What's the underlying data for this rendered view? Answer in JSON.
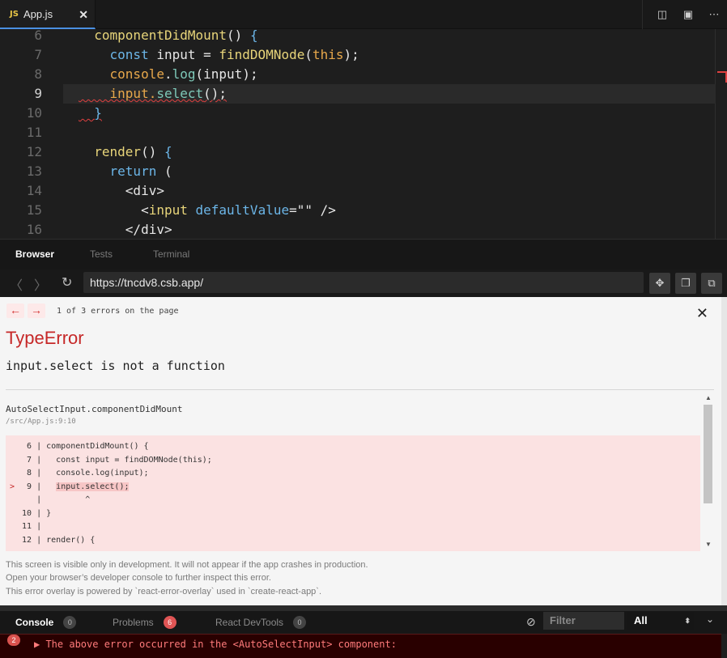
{
  "editor_tab": {
    "lang_badge": "JS",
    "filename": "App.js",
    "close": "✕"
  },
  "tab_actions": {
    "split": "◫",
    "preview": "▣",
    "more": "⋯"
  },
  "code_lines": [
    {
      "num": "6",
      "parts": [
        {
          "t": "  componentDidMount",
          "c": "k-yellow"
        },
        {
          "t": "() ",
          "c": "k-plain"
        },
        {
          "t": "{",
          "c": "k-blue"
        }
      ]
    },
    {
      "num": "7",
      "parts": [
        {
          "t": "    const ",
          "c": "k-blue"
        },
        {
          "t": "input = ",
          "c": "k-plain"
        },
        {
          "t": "findDOMNode",
          "c": "k-yellow"
        },
        {
          "t": "(",
          "c": "k-plain"
        },
        {
          "t": "this",
          "c": "k-orange"
        },
        {
          "t": ");",
          "c": "k-plain"
        }
      ]
    },
    {
      "num": "8",
      "parts": [
        {
          "t": "    console",
          "c": "k-orange"
        },
        {
          "t": ".",
          "c": "k-plain"
        },
        {
          "t": "log",
          "c": "k-teal"
        },
        {
          "t": "(input);",
          "c": "k-plain"
        }
      ]
    },
    {
      "num": "9",
      "parts": [
        {
          "t": "    input.",
          "c": "k-orange"
        },
        {
          "t": "select",
          "c": "k-teal"
        },
        {
          "t": "();",
          "c": "k-plain"
        }
      ]
    },
    {
      "num": "10",
      "parts": [
        {
          "t": "  }",
          "c": "k-blue"
        }
      ]
    },
    {
      "num": "11",
      "parts": []
    },
    {
      "num": "12",
      "parts": [
        {
          "t": "  render",
          "c": "k-yellow"
        },
        {
          "t": "() ",
          "c": "k-plain"
        },
        {
          "t": "{",
          "c": "k-blue"
        }
      ]
    },
    {
      "num": "13",
      "parts": [
        {
          "t": "    return ",
          "c": "k-blue"
        },
        {
          "t": "(",
          "c": "k-plain"
        }
      ]
    },
    {
      "num": "14",
      "parts": [
        {
          "t": "      <div>",
          "c": "k-plain"
        }
      ]
    },
    {
      "num": "15",
      "parts": [
        {
          "t": "        <",
          "c": "k-plain"
        },
        {
          "t": "input ",
          "c": "k-yellow"
        },
        {
          "t": "defaultValue",
          "c": "k-blue"
        },
        {
          "t": "=\"\" />",
          "c": "k-plain"
        }
      ]
    },
    {
      "num": "16",
      "parts": [
        {
          "t": "      </div>",
          "c": "k-plain"
        }
      ]
    }
  ],
  "panel_tabs": {
    "browser": "Browser",
    "tests": "Tests",
    "terminal": "Terminal"
  },
  "browser": {
    "back": "〈",
    "forward": "〉",
    "refresh": "↻",
    "url": "https://tncdv8.csb.app/",
    "btn1": "✥",
    "btn2": "❐",
    "btn3": "⧉"
  },
  "overlay": {
    "prev": "←",
    "next": "→",
    "counter": "1 of 3 errors on the page",
    "close": "✕",
    "title": "TypeError",
    "message": "input.select is not a function",
    "frame_function": "AutoSelectInput.componentDidMount",
    "frame_location": "/src/App.js:9:10",
    "snippet": [
      {
        "gt": "",
        "text": "  6 | componentDidMount() {",
        "hl": false
      },
      {
        "gt": "",
        "text": "  7 |   const input = findDOMNode(this);",
        "hl": false
      },
      {
        "gt": "",
        "text": "  8 |   console.log(input);",
        "hl": false
      },
      {
        "gt": ">",
        "text": "  9 |   input.select();",
        "hl": true
      },
      {
        "gt": "",
        "text": "    |         ^",
        "hl": false
      },
      {
        "gt": "",
        "text": " 10 | }",
        "hl": false
      },
      {
        "gt": "",
        "text": " 11 |",
        "hl": false
      },
      {
        "gt": "",
        "text": " 12 | render() {",
        "hl": false
      }
    ],
    "footer": [
      "This screen is visible only in development. It will not appear if the app crashes in production.",
      "Open your browser’s developer console to further inspect this error.",
      "This error overlay is powered by `react-error-overlay` used in `create-react-app`."
    ],
    "scroll_up": "▲",
    "scroll_down": "▼"
  },
  "console_bar": {
    "console": "Console",
    "console_count": "0",
    "problems": "Problems",
    "problems_count": "6",
    "devtools": "React DevTools",
    "devtools_count": "0",
    "clear_icon": "⊘",
    "filter_placeholder": "Filter",
    "level": "All",
    "level_caret": "⬍",
    "collapse": "⌄"
  },
  "console_error": {
    "count": "2",
    "message": "▶ The above error occurred in the <AutoSelectInput> component:"
  }
}
